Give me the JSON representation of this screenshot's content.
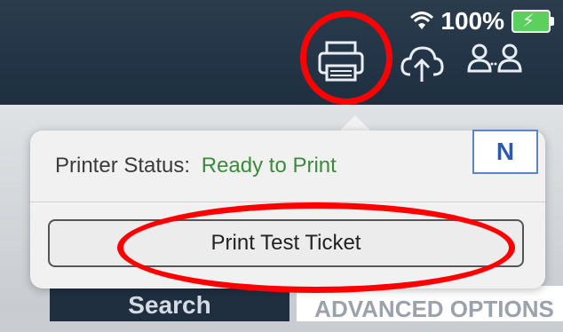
{
  "status_bar": {
    "battery_percent": "100%",
    "wifi_icon": "wifi-icon",
    "battery_icon": "battery-charging-icon"
  },
  "toolbar": {
    "icons": [
      "printer-icon",
      "cloud-upload-icon",
      "users-icon"
    ]
  },
  "popover": {
    "status_label": "Printer Status:",
    "status_value": "Ready to Print",
    "test_button": "Print Test Ticket"
  },
  "badge": {
    "label": "N"
  },
  "bottom": {
    "left_label": "Search",
    "right_label": "ADVANCED OPTIONS"
  },
  "colors": {
    "highlight": "#ff0000",
    "status_ok": "#3d8a3d",
    "topbar": "#233446"
  }
}
